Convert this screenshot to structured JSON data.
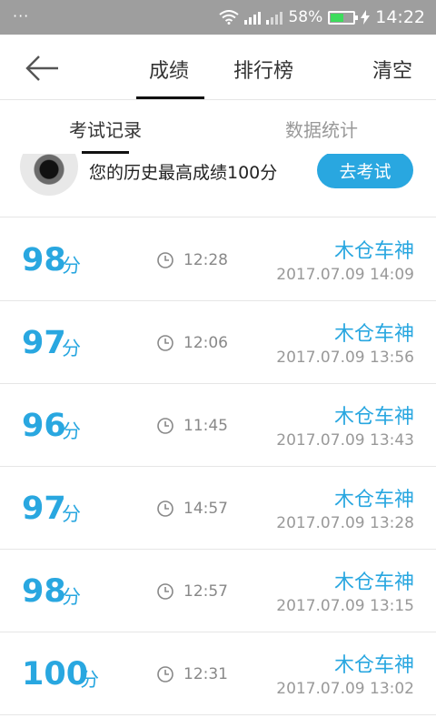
{
  "status_bar": {
    "dots": "···",
    "battery": "58%",
    "battery_level": 0.58,
    "time": "14:22",
    "battery_color": "#3ddc5c"
  },
  "header": {
    "tabs": [
      "成绩",
      "排行榜"
    ],
    "active_tab": 0,
    "clear": "清空"
  },
  "subtabs": [
    "考试记录",
    "数据统计"
  ],
  "best": {
    "text": "您的历史最高成绩100分",
    "button": "去考试"
  },
  "unit": "分",
  "records": [
    {
      "score": "98",
      "duration": "12:28",
      "name": "木仓车神",
      "date": "2017.07.09  14:09"
    },
    {
      "score": "97",
      "duration": "12:06",
      "name": "木仓车神",
      "date": "2017.07.09  13:56"
    },
    {
      "score": "96",
      "duration": "11:45",
      "name": "木仓车神",
      "date": "2017.07.09  13:43"
    },
    {
      "score": "97",
      "duration": "14:57",
      "name": "木仓车神",
      "date": "2017.07.09  13:28"
    },
    {
      "score": "98",
      "duration": "12:57",
      "name": "木仓车神",
      "date": "2017.07.09  13:15"
    },
    {
      "score": "100",
      "duration": "12:31",
      "name": "木仓车神",
      "date": "2017.07.09  13:02"
    }
  ],
  "colors": {
    "accent": "#29a7e0",
    "status_bar": "#9e9e9e"
  }
}
